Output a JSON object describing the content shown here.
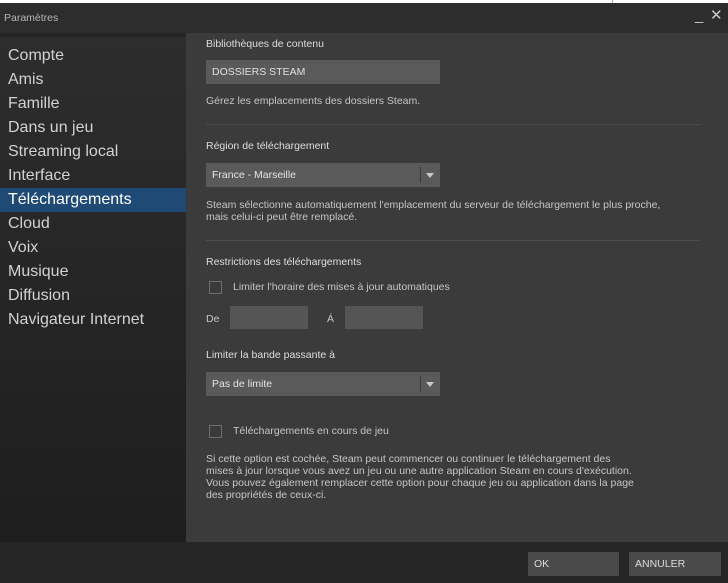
{
  "window": {
    "title": "Paramètres",
    "minimize_glyph": "_",
    "close_glyph": "✕"
  },
  "sidebar": {
    "items": [
      {
        "label": "Compte"
      },
      {
        "label": "Amis"
      },
      {
        "label": "Famille"
      },
      {
        "label": "Dans un jeu"
      },
      {
        "label": "Streaming local"
      },
      {
        "label": "Interface"
      },
      {
        "label": "Téléchargements",
        "selected": true
      },
      {
        "label": "Cloud"
      },
      {
        "label": "Voix"
      },
      {
        "label": "Musique"
      },
      {
        "label": "Diffusion"
      },
      {
        "label": "Navigateur Internet"
      }
    ]
  },
  "content_libraries": {
    "heading": "Bibliothèques de contenu",
    "button_label": "DOSSIERS STEAM",
    "description": "Gérez les emplacements des dossiers Steam."
  },
  "download_region": {
    "heading": "Région de téléchargement",
    "selected": "France - Marseille",
    "description": "Steam sélectionne automatiquement l'emplacement du serveur de téléchargement le plus proche,\nmais celui-ci peut être remplacé."
  },
  "restrictions": {
    "heading": "Restrictions des téléchargements",
    "schedule_label": "Limiter l'horaire des mises à jour automatiques",
    "schedule_checked": false,
    "from_label": "De",
    "to_label": "Á",
    "from_value": "",
    "to_value": "",
    "bandwidth_label": "Limiter la bande passante à",
    "bandwidth_selected": "Pas de limite"
  },
  "ingame": {
    "label": "Téléchargements en cours de jeu",
    "checked": false,
    "description": "Si cette option est cochée, Steam peut commencer ou continuer le téléchargement des\nmises à jour lorsque vous avez un jeu ou une autre application Steam en cours d'exécution.\nVous pouvez également remplacer cette option pour chaque jeu ou application dans la page\ndes propriétés de ceux-ci."
  },
  "footer": {
    "ok_label": "OK",
    "cancel_label": "ANNULER"
  },
  "icons": {
    "minimize": "minimize-icon",
    "close": "close-icon",
    "dropdown": "chevron-down-icon"
  },
  "colors": {
    "selected_nav": "#1f4a75",
    "panel": "#3b3b3b",
    "control": "#5a5a5a"
  }
}
